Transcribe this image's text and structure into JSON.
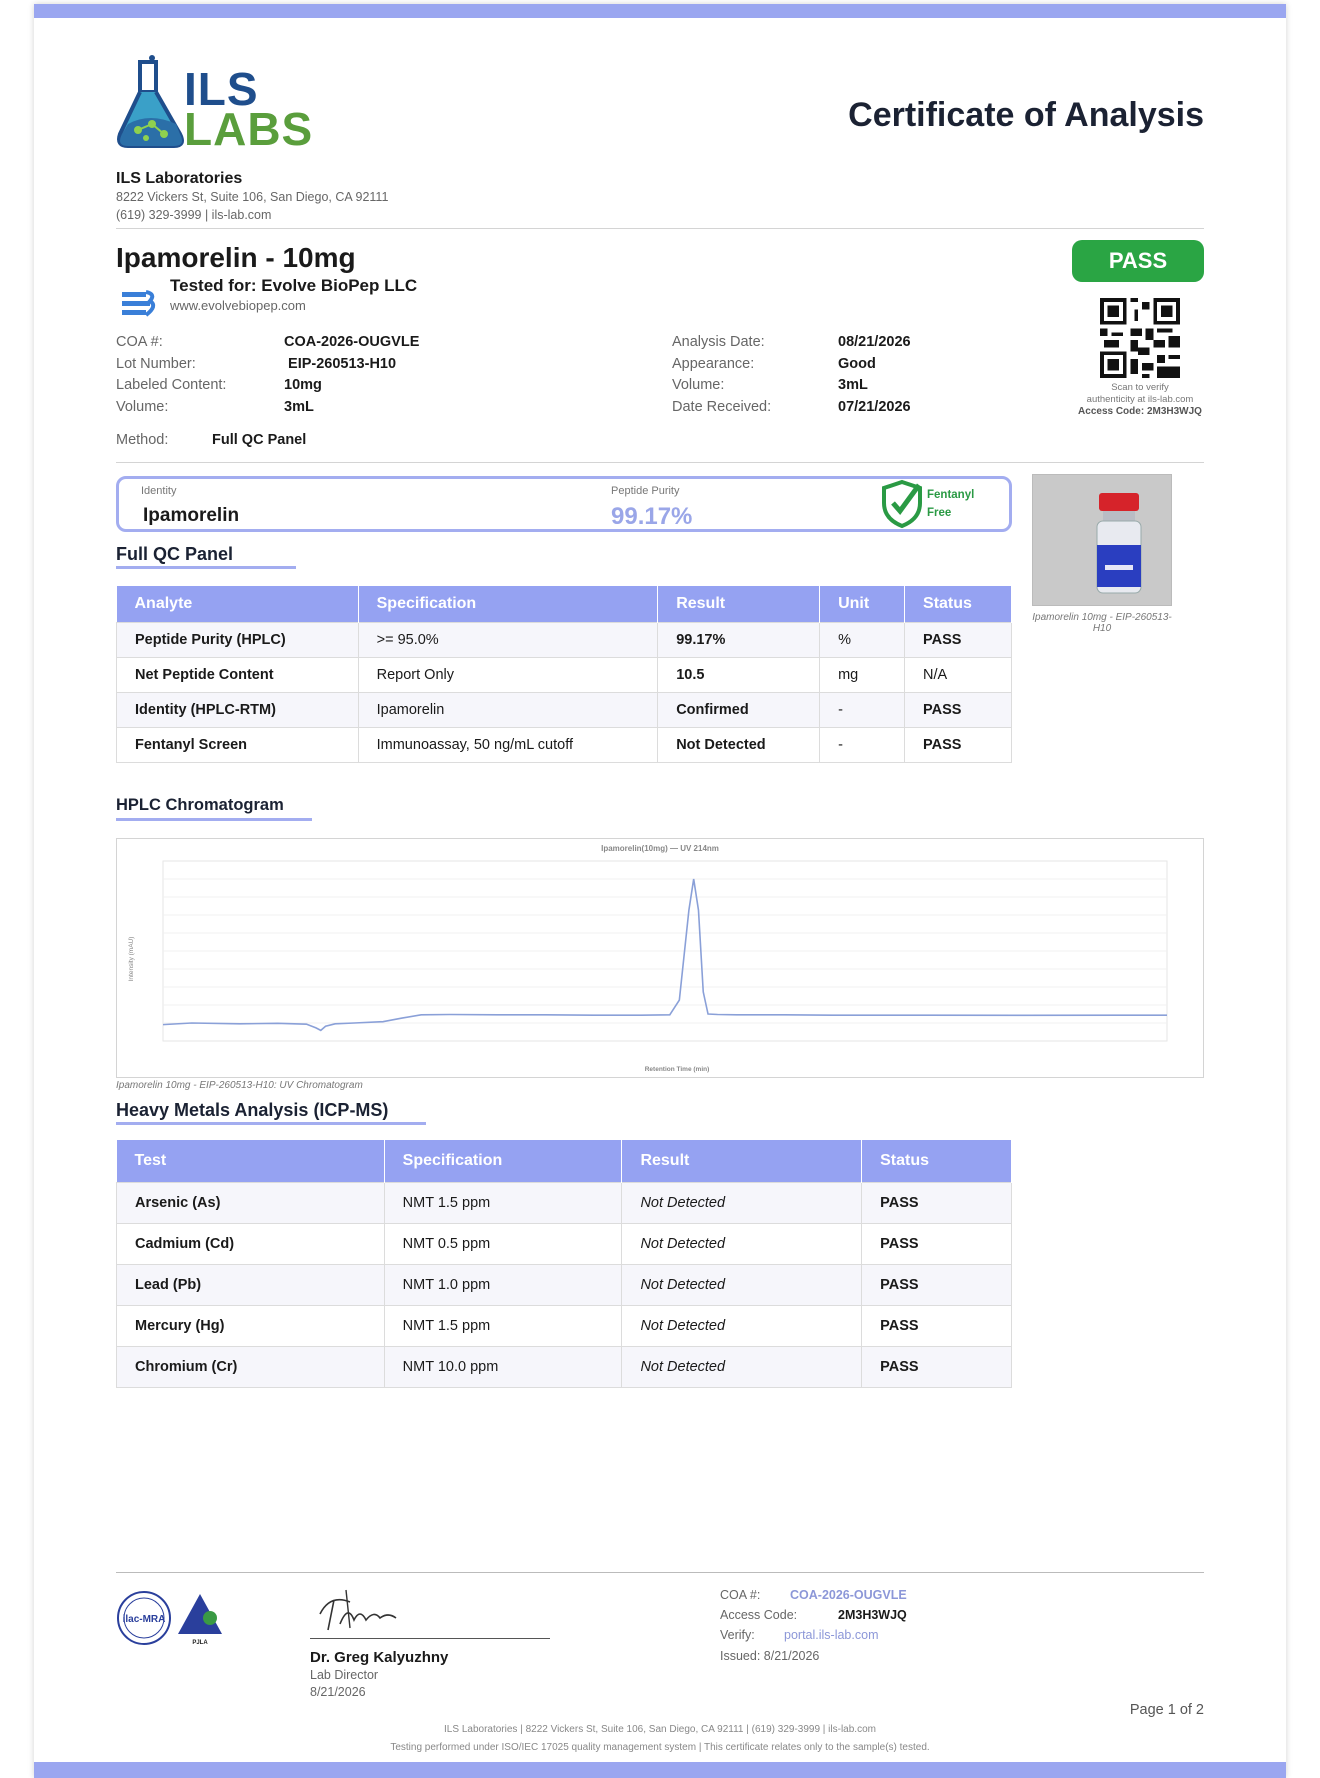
{
  "header": {
    "logo_top": "ILS",
    "logo_bottom": "LABS",
    "title": "Certificate of Analysis",
    "lab_name": "ILS Laboratories",
    "lab_address": "8222 Vickers St, Suite 106, San Diego, CA 92111",
    "lab_contact": "(619) 329-3999  |  ils-lab.com"
  },
  "product": {
    "name": "Ipamorelin - 10mg",
    "tested_for": "Tested for: Evolve BioPep LLC",
    "client_url": "www.evolvebiopep.com",
    "overall_status": "PASS"
  },
  "qr": {
    "caption_1": "Scan to verify",
    "caption_2": "authenticity at ils-lab.com",
    "access_code": "Access Code: 2M3H3WJQ"
  },
  "details_left": [
    {
      "label": "COA #:",
      "value": "COA-2026-OUGVLE"
    },
    {
      "label": "Lot Number:",
      "value": " EIP-260513-H10"
    },
    {
      "label": "Labeled Content:",
      "value": "10mg"
    },
    {
      "label": "Volume:",
      "value": "3mL"
    }
  ],
  "details_right": [
    {
      "label": "Analysis Date:",
      "value": "08/21/2026"
    },
    {
      "label": "Appearance:",
      "value": "Good"
    },
    {
      "label": "Volume:",
      "value": "3mL"
    },
    {
      "label": "Date Received:",
      "value": "07/21/2026"
    }
  ],
  "method": {
    "label": "Method:",
    "value": "Full QC Panel"
  },
  "identity_box": {
    "identity_label": "Identity",
    "identity_value": "Ipamorelin",
    "purity_label": "Peptide Purity",
    "purity_value": "99.17%",
    "fentanyl_line1": "Fentanyl",
    "fentanyl_line2": "Free"
  },
  "vial": {
    "caption": "Ipamorelin 10mg -  EIP-260513-H10"
  },
  "qc_panel": {
    "title": "Full QC Panel",
    "columns": [
      "Analyte",
      "Specification",
      "Result",
      "Unit",
      "Status"
    ],
    "rows": [
      [
        "Peptide Purity (HPLC)",
        ">= 95.0%",
        "99.17%",
        "%",
        "PASS"
      ],
      [
        "Net Peptide Content",
        "Report Only",
        "10.5",
        "mg",
        "N/A"
      ],
      [
        "Identity (HPLC-RTM)",
        "Ipamorelin",
        "Confirmed",
        "-",
        "PASS"
      ],
      [
        "Fentanyl Screen",
        "Immunoassay, 50 ng/mL cutoff",
        "Not Detected",
        "-",
        "PASS"
      ]
    ]
  },
  "chromatogram": {
    "title": "HPLC Chromatogram",
    "caption": "Ipamorelin 10mg -  EIP-260513-H10: UV Chromatogram",
    "line_color": "#8aa0d8"
  },
  "chart_data": {
    "type": "line",
    "title": "Ipamorelin(10mg) — UV 214nm",
    "xlabel": "Retention Time (min)",
    "ylabel": "Intensity (mAU)",
    "xlim": [
      0,
      10.5
    ],
    "ylim": [
      -100,
      1000
    ],
    "series": [
      {
        "x": [
          0,
          0.3,
          0.8,
          1.2,
          1.5,
          1.6,
          1.65,
          1.7,
          1.8,
          2.0,
          2.3,
          2.5,
          2.7,
          3.0,
          3.5,
          4.0,
          4.5,
          5.0,
          5.3,
          5.4,
          5.5,
          5.55,
          5.6,
          5.65,
          5.7,
          5.8,
          6.0,
          6.5,
          7.0,
          8.0,
          9.0,
          10.0,
          10.5
        ],
        "y": [
          0,
          10,
          5,
          8,
          3,
          -20,
          -35,
          -10,
          5,
          10,
          18,
          40,
          60,
          62,
          60,
          60,
          58,
          58,
          60,
          150,
          700,
          890,
          700,
          200,
          65,
          62,
          60,
          60,
          58,
          58,
          57,
          58,
          58
        ]
      }
    ]
  },
  "heavy_metals": {
    "title": "Heavy Metals Analysis (ICP-MS)",
    "columns": [
      "Test",
      "Specification",
      "Result",
      "Status"
    ],
    "rows": [
      [
        "Arsenic (As)",
        "NMT 1.5 ppm",
        "Not Detected",
        "PASS"
      ],
      [
        "Cadmium (Cd)",
        "NMT 0.5 ppm",
        "Not Detected",
        "PASS"
      ],
      [
        "Lead (Pb)",
        "NMT 1.0 ppm",
        "Not Detected",
        "PASS"
      ],
      [
        "Mercury (Hg)",
        "NMT 1.5 ppm",
        "Not Detected",
        "PASS"
      ],
      [
        "Chromium (Cr)",
        "NMT 10.0 ppm",
        "Not Detected",
        "PASS"
      ]
    ]
  },
  "footer": {
    "signer_name": "Dr. Greg Kalyuzhny",
    "signer_role": "Lab Director",
    "signer_date": "8/21/2026",
    "coa_label": "COA #:",
    "coa_value": "COA-2026-OUGVLE",
    "access_label": "Access Code:",
    "access_value": "2M3H3WJQ",
    "verify_label": "Verify:",
    "verify_value": "portal.ils-lab.com",
    "issued": "Issued: 8/21/2026",
    "page": "Page 1 of 2",
    "fine_1": "ILS Laboratories  |  8222 Vickers St, Suite 106, San Diego, CA 92111  |  (619) 329-3999  |  ils-lab.com",
    "fine_2": "Testing performed under ISO/IEC 17025 quality management system  |  This certificate relates only to the sample(s) tested.",
    "accred_1": "ilac-MRA",
    "accred_2": "PJLA"
  },
  "colors": {
    "accent": "#95a2f2",
    "pass": "#2aa544",
    "logo_blue": "#1f4e8c",
    "logo_green": "#5a9e3c"
  }
}
